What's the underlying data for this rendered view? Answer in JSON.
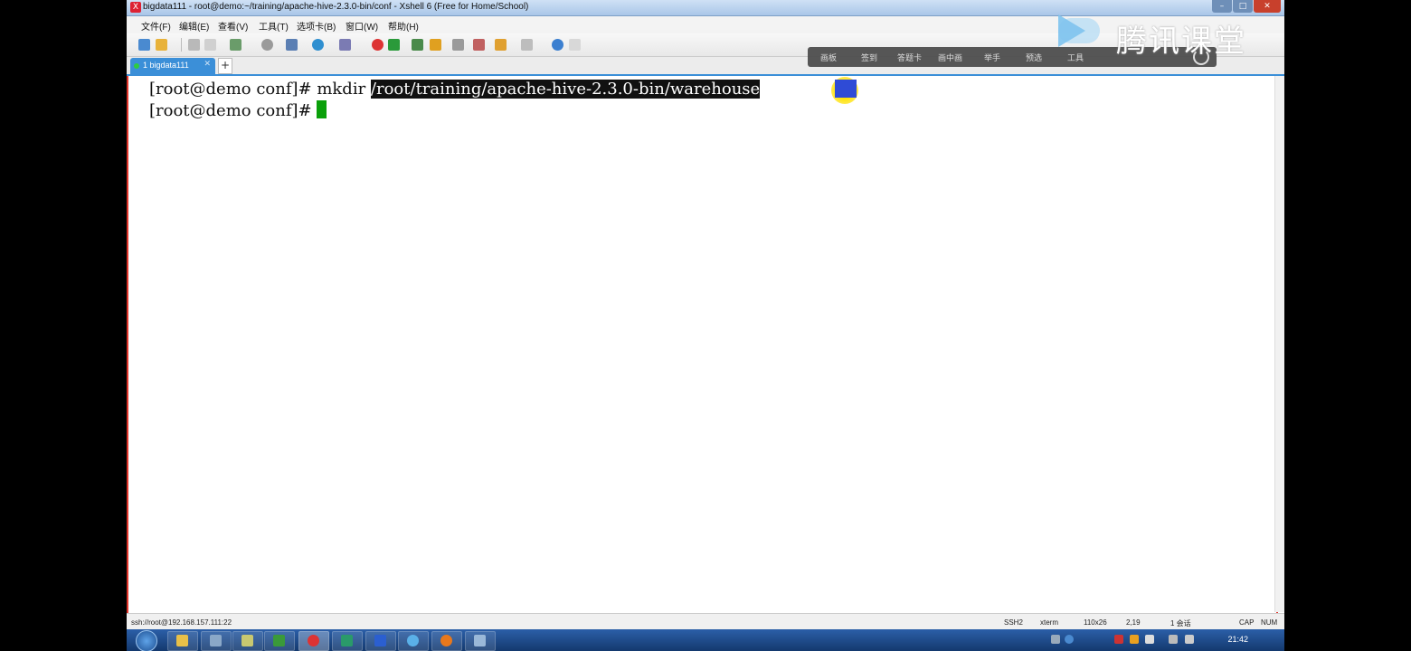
{
  "window": {
    "title": "bigdata111 - root@demo:~/training/apache-hive-2.3.0-bin/conf - Xshell 6 (Free for Home/School)"
  },
  "menu": [
    {
      "label": "文件(F)"
    },
    {
      "label": "编辑(E)"
    },
    {
      "label": "查看(V)"
    },
    {
      "label": "工具(T)"
    },
    {
      "label": "选项卡(B)"
    },
    {
      "label": "窗口(W)"
    },
    {
      "label": "帮助(H)"
    }
  ],
  "tabs": {
    "active_label": "1 bigdata111",
    "add_label": "+"
  },
  "overlay": {
    "buttons": [
      "画板",
      "签到",
      "答题卡",
      "画中画",
      "举手",
      "预选",
      "工具"
    ],
    "logo_text": "腾讯课堂"
  },
  "terminal": {
    "line1_prompt": "[root@demo conf]# mkdir ",
    "line1_selected": "/root/training/apache-hive-2.3.0-bin/warehouse",
    "line2_prompt": "[root@demo conf]# "
  },
  "status": {
    "connection": "ssh://root@192.168.157.111:22",
    "protocol": "SSH2",
    "term": "xterm",
    "size": "110x26",
    "cursor_pos": "2,19",
    "sessions": "1 会话",
    "caps": "CAP",
    "num": "NUM"
  },
  "taskbar": {
    "clock": "21:42"
  },
  "colors": {
    "tab_accent": "#3b8fd8",
    "cursor": "#0aa00a",
    "close_red": "#c8402c"
  }
}
